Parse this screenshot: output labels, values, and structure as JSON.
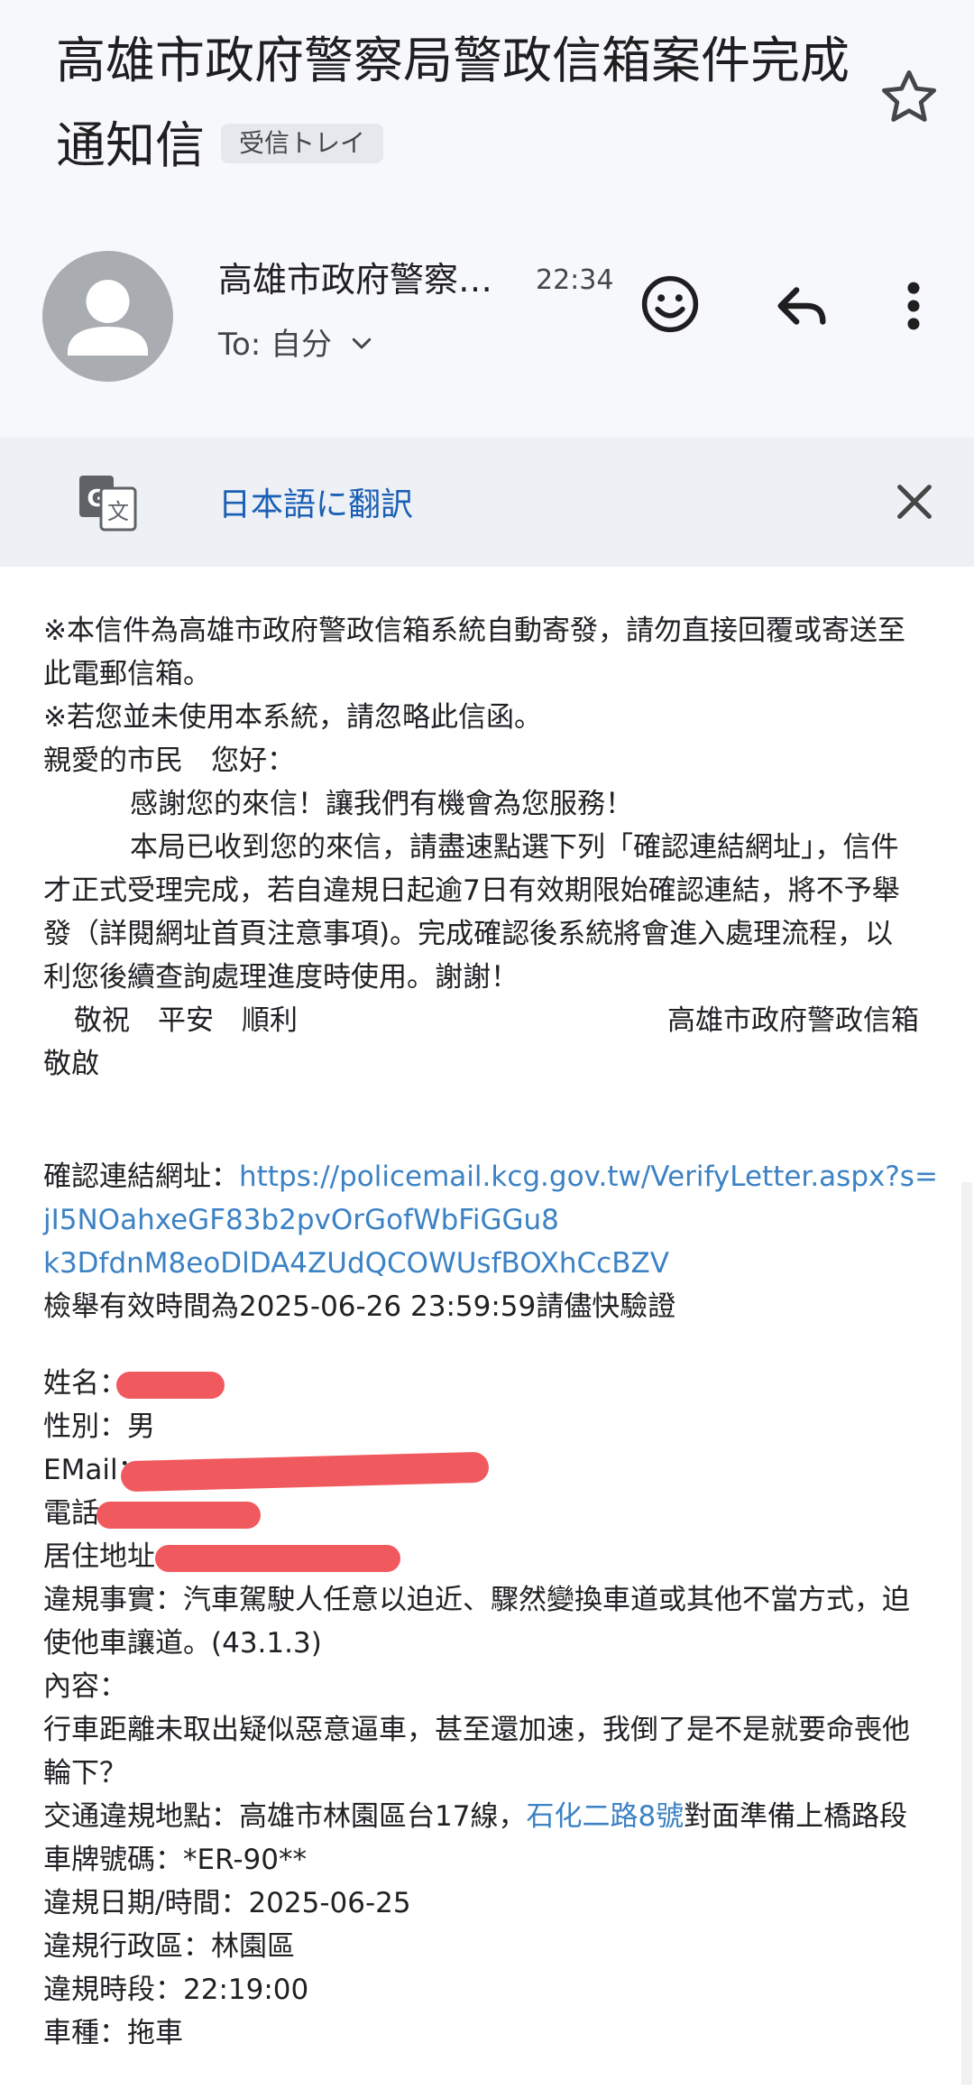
{
  "header": {
    "subject": "高雄市政府警察局警政信箱案件完成通知信",
    "inbox_label": "受信トレイ"
  },
  "message_meta": {
    "sender": "高雄市政府警察局警政信箱",
    "time": "22:34",
    "to_label": "To: 自分"
  },
  "translate_bar": {
    "link_label": "日本語に翻訳"
  },
  "body": {
    "line1": "※本信件為高雄市政府警政信箱系統自動寄發，請勿直接回覆或寄送至",
    "line2": "此電郵信箱。",
    "line3": "※若您並未使用本系統，請忽略此信函。",
    "greeting": "親愛的市民　您好：",
    "thanks": "感謝您的來信！讓我們有機會為您服務！",
    "p2_line1": "本局已收到您的來信，請盡速點選下列「確認連結網址」，信件",
    "p2_line2": "才正式受理完成，若自違規日起逾7日有效期限始確認連結，將不予舉",
    "p2_line3": "發（詳閱網址首頁注意事項)。完成確認後系統將會進入處理流程，以",
    "p2_line4": "利您後續查詢處理進度時使用。謝謝！",
    "regards": "敬祝　平安　順利",
    "signature": "高雄市政府警政信箱",
    "sign_close": "敬啟",
    "confirm_label": "確認連結網址：",
    "confirm_url_1": "https://policemail.kcg.gov.tw/VerifyLetter.aspx?s=",
    "confirm_url_2": "jI5NOahxeGF83b2pvOrGofWbFiGGu8",
    "confirm_url_3": "k3DfdnM8eoDlDA4ZUdQCOWUsfBOXhCcBZV",
    "valid_until": "檢舉有效時間為2025-06-26 23:59:59請儘快驗證",
    "name_label": "姓名：",
    "gender": "性別：男",
    "email_label": "EMail：",
    "phone_label": "電話：",
    "address_label": "居住地址",
    "violation_1": "違規事實：汽車駕駛人任意以迫近、驟然變換車道或其他不當方式，迫",
    "violation_2": "使他車讓道。(43.1.3)",
    "content_label": "內容：",
    "content_1": "行車距離未取出疑似惡意逼車，甚至還加速，我倒了是不是就要命喪他",
    "content_2": "輪下？",
    "location_prefix": "交通違規地點：高雄市林園區台17線，",
    "location_link": "石化二路8號",
    "location_suffix": "對面準備上橋路段",
    "plate": "車牌號碼：*ER-90**",
    "date": "違規日期/時間：2025-06-25",
    "district": "違規行政區：林園區",
    "time_slot": "違規時段：22:19:00",
    "vehicle": "車種：拖車"
  },
  "icons": {
    "star": "star-outline-icon",
    "avatar": "person-avatar-icon",
    "expand": "chevron-down-icon",
    "emoji": "emoji-smile-icon",
    "reply": "reply-icon",
    "more": "more-vert-icon",
    "translate": "google-translate-icon",
    "close": "close-icon"
  },
  "colors": {
    "link": "#3c82c4",
    "translate_link": "#1a5fb4",
    "redaction": "#f05a5e",
    "header_bg": "#f7f8fc"
  }
}
